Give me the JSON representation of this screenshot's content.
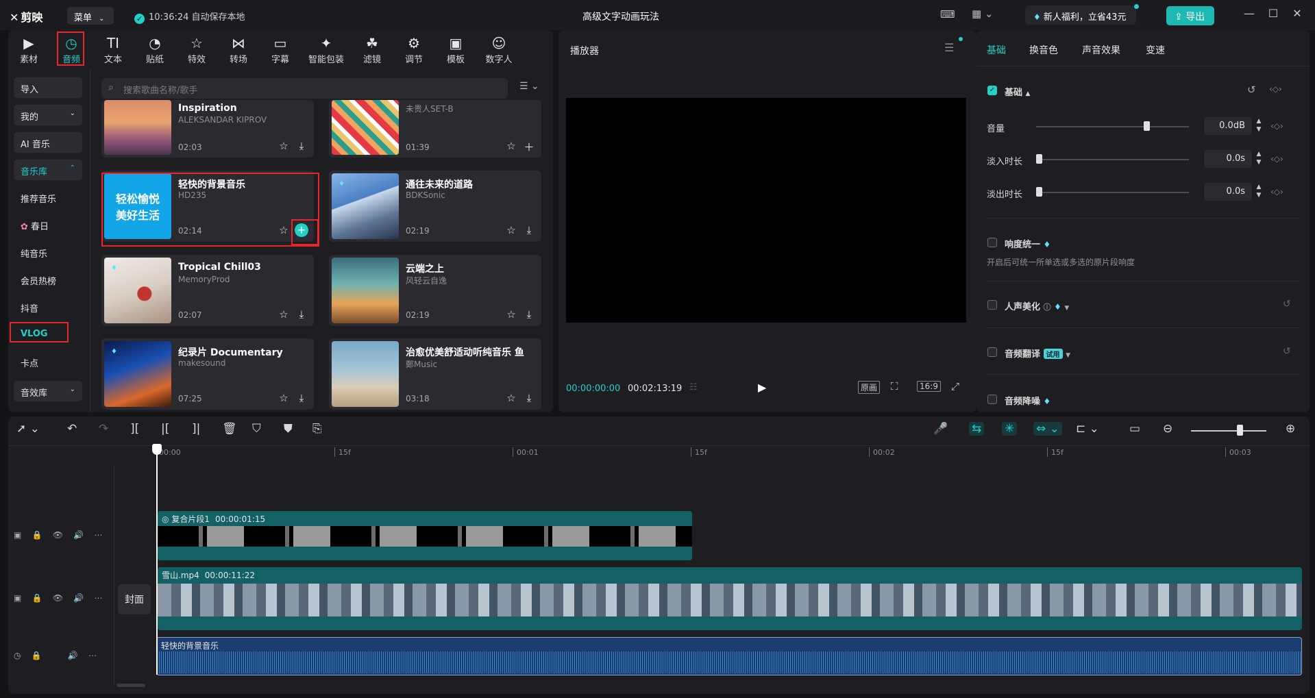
{
  "app": {
    "logo": "剪映",
    "menu_label": "菜单",
    "autosave": "10:36:24 自动保存本地",
    "doc_title": "高级文字动画玩法",
    "promo": "新人福利，立省43元",
    "export_label": "导出"
  },
  "toolbar": [
    {
      "label": "素材",
      "icon": "media-icon"
    },
    {
      "label": "音频",
      "icon": "audio-icon"
    },
    {
      "label": "文本",
      "icon": "text-icon"
    },
    {
      "label": "贴纸",
      "icon": "sticker-icon"
    },
    {
      "label": "特效",
      "icon": "effects-icon"
    },
    {
      "label": "转场",
      "icon": "transition-icon"
    },
    {
      "label": "字幕",
      "icon": "subtitle-icon"
    },
    {
      "label": "智能包装",
      "icon": "smart-pack-icon"
    },
    {
      "label": "滤镜",
      "icon": "filter-icon"
    },
    {
      "label": "调节",
      "icon": "adjust-icon"
    },
    {
      "label": "模板",
      "icon": "template-icon"
    },
    {
      "label": "数字人",
      "icon": "digital-human-icon"
    }
  ],
  "sidebar": {
    "import": "导入",
    "mine": "我的",
    "ai_music": "AI 音乐",
    "library": "音乐库",
    "items": [
      "推荐音乐",
      "春日",
      "纯音乐",
      "会员热榜",
      "抖音",
      "VLOG",
      "卡点"
    ],
    "sfx_library": "音效库"
  },
  "search": {
    "placeholder": "搜索歌曲名称/歌手"
  },
  "cards": [
    {
      "name": "Inspiration",
      "artist": "ALEKSANDAR KIPROV",
      "duration": "02:03"
    },
    {
      "name": "",
      "artist": "未贵人SET-B",
      "duration": "01:39"
    },
    {
      "name": "轻快的背景音乐",
      "artist": "HD235",
      "duration": "02:14",
      "thumb_text_1": "轻松愉悦",
      "thumb_text_2": "美好生活"
    },
    {
      "name": "通往未来的道路",
      "artist": "BDKSonic",
      "duration": "02:19"
    },
    {
      "name": "Tropical Chill03",
      "artist": "MemoryProd",
      "duration": "02:07"
    },
    {
      "name": "云端之上",
      "artist": "风轻云自逸",
      "duration": "02:19"
    },
    {
      "name": "纪录片 Documentary",
      "artist": "makesound",
      "duration": "07:25"
    },
    {
      "name": "治愈优美舒适动听纯音乐 鱼",
      "artist": "鄭Music",
      "duration": "03:18"
    }
  ],
  "player": {
    "title": "播放器",
    "current": "00:00:00:00",
    "total": "00:02:13:19",
    "original": "原画",
    "ratio": "16:9"
  },
  "props": {
    "tabs": [
      "基础",
      "换音色",
      "声音效果",
      "变速"
    ],
    "section_basic": "基础",
    "volume_label": "音量",
    "volume_value": "0.0dB",
    "volume_level": 0.72,
    "fade_in_label": "淡入时长",
    "fade_in_value": "0.0s",
    "fade_out_label": "淡出时长",
    "fade_out_value": "0.0s",
    "loudness_label": "响度统一",
    "loudness_desc": "开启后可统一所单选或多选的原片段响度",
    "voice_beauty": "人声美化",
    "translate": "音频翻译",
    "trial": "试用",
    "denoise": "音频降噪"
  },
  "timeline": {
    "ruler": [
      "00:00",
      "15f",
      "00:01",
      "15f",
      "00:02",
      "15f",
      "00:03"
    ],
    "cover": "封面",
    "compound_clip": {
      "name": "复合片段1",
      "duration": "00:00:01:15"
    },
    "video_clip": {
      "name": "雪山.mp4",
      "duration": "00:00:11:22"
    },
    "audio_clip": {
      "name": "轻快的背景音乐"
    }
  },
  "colors": {
    "accent": "#1fd1c7",
    "highlight": "#e8262c"
  }
}
